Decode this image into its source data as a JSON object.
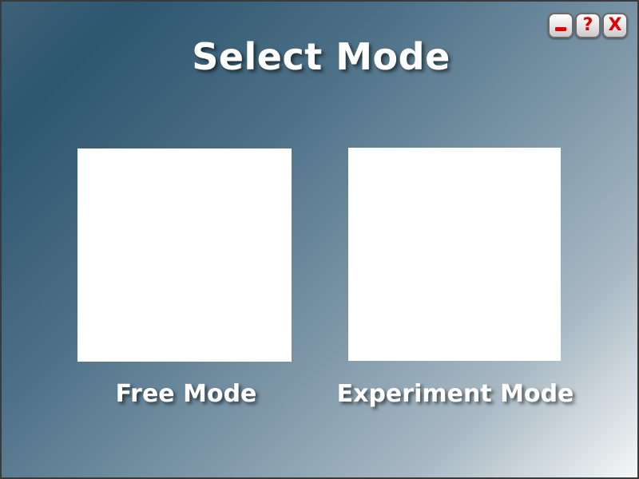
{
  "window": {
    "title": "Select Mode",
    "buttons": {
      "minimize_icon": "minimize-icon",
      "help_label": "?",
      "close_label": "X"
    }
  },
  "modes": [
    {
      "label": "Free Mode"
    },
    {
      "label": "Experiment Mode"
    }
  ],
  "colors": {
    "accent": "#e00000",
    "background_start": "#2e566f",
    "background_end": "#f5f7f8",
    "card": "#ffffff"
  }
}
